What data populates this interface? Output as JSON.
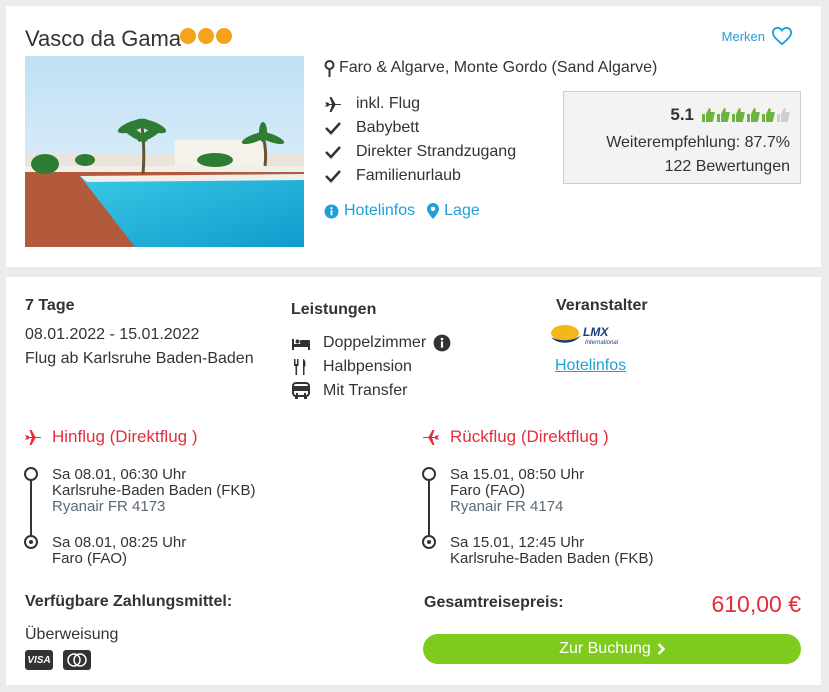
{
  "hotel": {
    "name": "Vasco da Gama",
    "star_dots": 3,
    "merken_label": "Merken",
    "location": "Faro & Algarve, Monte Gordo (Sand Algarve)",
    "features": [
      "inkl. Flug",
      "Babybett",
      "Direkter Strandzugang",
      "Familienurlaub"
    ],
    "links": {
      "hotelinfos": "Hotelinfos",
      "lage": "Lage"
    },
    "rating": {
      "score": "5.1",
      "thumbs_full": 5,
      "thumbs_total": 6,
      "recommendation": "Weiterempfehlung: 87.7%",
      "reviews": "122 Bewertungen"
    }
  },
  "offer": {
    "duration": "7 Tage",
    "dates": "08.01.2022 - 15.01.2022",
    "departure": "Flug ab Karlsruhe Baden-Baden",
    "services_title": "Leistungen",
    "services": [
      "Doppelzimmer",
      "Halbpension",
      "Mit Transfer"
    ],
    "operator_title": "Veranstalter",
    "operator_logo_text": "LMX",
    "operator_logo_sub": "International",
    "operator_link": "Hotelinfos",
    "outbound": {
      "title": "Hinflug (Direktflug )",
      "dep_time": "Sa 08.01, 06:30 Uhr",
      "dep_airport": "Karlsruhe-Baden Baden (FKB)",
      "airline": "Ryanair FR 4173",
      "arr_time": "Sa 08.01, 08:25 Uhr",
      "arr_airport": "Faro (FAO)"
    },
    "return": {
      "title": "Rückflug (Direktflug )",
      "dep_time": "Sa 15.01, 08:50 Uhr",
      "dep_airport": "Faro (FAO)",
      "airline": "Ryanair FR 4174",
      "arr_time": "Sa 15.01, 12:45 Uhr",
      "arr_airport": "Karlsruhe-Baden Baden (FKB)"
    },
    "payment_title": "Verfügbare Zahlungsmittel:",
    "payment_method": "Überweisung",
    "payment_cards": [
      "VISA",
      "Mastercard"
    ],
    "total_label": "Gesamtreisepreis:",
    "total_price": "610,00 €",
    "book_label": "Zur Buchung"
  },
  "colors": {
    "accent_blue": "#1ea0d9",
    "flight_red": "#e52d3a",
    "button_green": "#7ecb1d",
    "star_orange": "#f7a21b",
    "thumb_green": "#6db33f"
  }
}
